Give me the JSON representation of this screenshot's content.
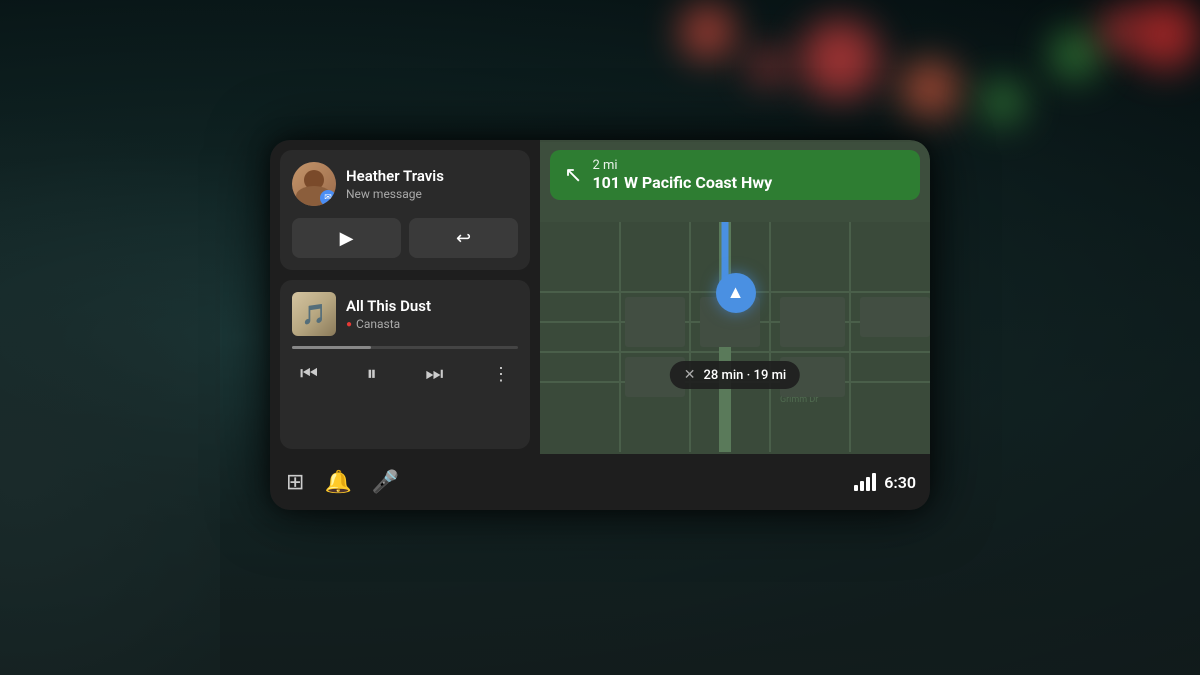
{
  "background": {
    "color": "#0a1a1f"
  },
  "screen": {
    "message_card": {
      "sender_name": "Heather Travis",
      "subtitle": "New message",
      "play_label": "▶",
      "reply_label": "↩"
    },
    "music_card": {
      "title": "All This Dust",
      "artist": "Canasta",
      "artist_icon": "●"
    },
    "music_controls": {
      "prev": "⏮",
      "pause": "⏸",
      "next": "⏭",
      "more": "⋮"
    },
    "bottom_bar": {
      "grid_icon": "⊞",
      "bell_icon": "🔔",
      "mic_icon": "🎤",
      "time": "6:30"
    },
    "navigation": {
      "turn_arrow": "↖",
      "distance": "2 mi",
      "road_name": "101 W Pacific Coast Hwy",
      "eta_close": "✕",
      "eta_text": "28 min · 19 mi"
    }
  }
}
